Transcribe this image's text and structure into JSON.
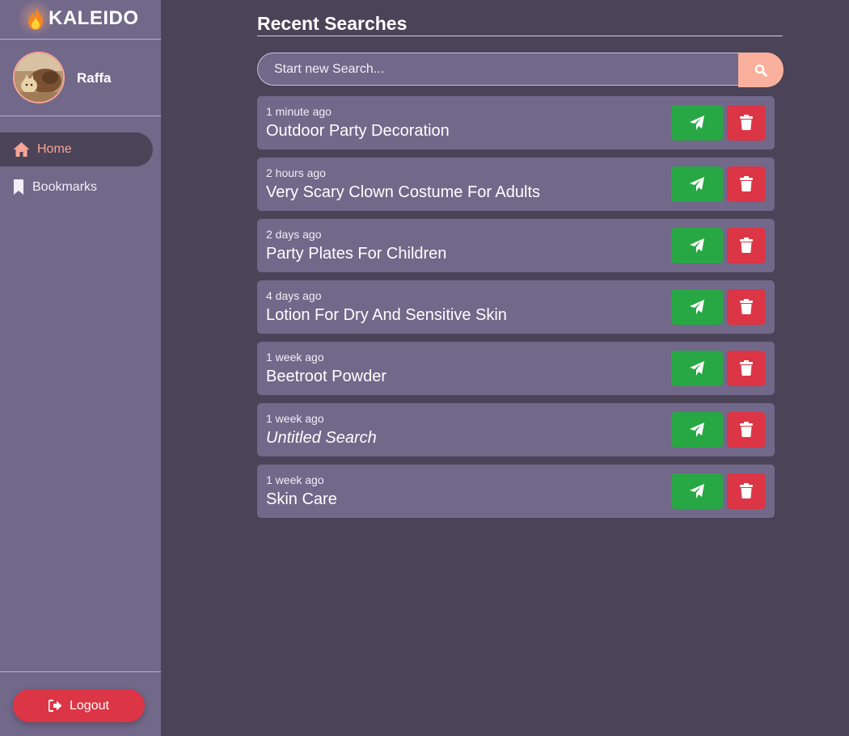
{
  "app": {
    "name": "KALEIDO",
    "logo_icon": "flame-icon"
  },
  "colors": {
    "sidebar_bg": "#72688a",
    "main_bg": "#4b4358",
    "accent": "#f7a495",
    "search_button": "#f9b09c",
    "go_button": "#28a745",
    "delete_button": "#dc3545"
  },
  "user": {
    "name": "Raffa",
    "avatar_icon": "avatar-photo"
  },
  "sidebar": {
    "items": [
      {
        "label": "Home",
        "icon": "home-icon",
        "active": true
      },
      {
        "label": "Bookmarks",
        "icon": "bookmark-icon",
        "active": false
      }
    ],
    "logout_label": "Logout",
    "logout_icon": "sign-out-icon"
  },
  "main": {
    "title": "Recent Searches",
    "search": {
      "placeholder": "Start new Search...",
      "value": "",
      "button_icon": "search-icon"
    },
    "results": [
      {
        "time": "1 minute ago",
        "query": "Outdoor Party Decoration"
      },
      {
        "time": "2 hours ago",
        "query": "Very Scary Clown Costume For Adults"
      },
      {
        "time": "2 days ago",
        "query": "Party Plates For Children"
      },
      {
        "time": "4 days ago",
        "query": "Lotion For Dry And Sensitive Skin"
      },
      {
        "time": "1 week ago",
        "query": "Beetroot Powder"
      },
      {
        "time": "1 week ago",
        "query": "Untitled Search"
      },
      {
        "time": "1 week ago",
        "query": "Skin Care"
      }
    ],
    "row_actions": {
      "go_icon": "paper-plane-icon",
      "delete_icon": "trash-icon"
    }
  }
}
